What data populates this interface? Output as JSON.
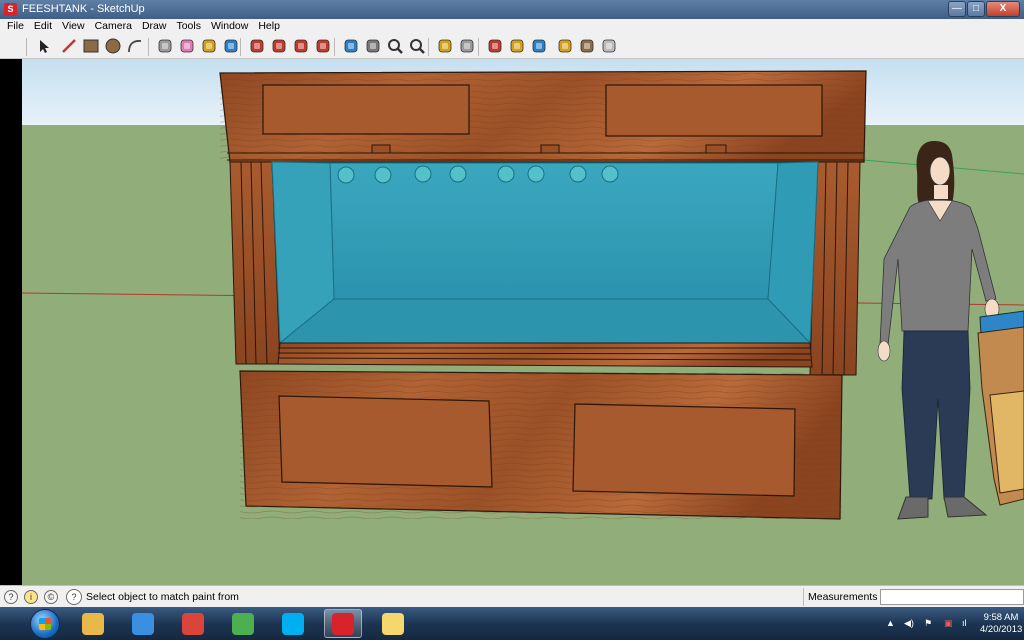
{
  "window": {
    "title": "FEESHTANK - SketchUp",
    "controls": {
      "minimize": "—",
      "maximize": "□",
      "close": "X"
    }
  },
  "menu": {
    "items": [
      "File",
      "Edit",
      "View",
      "Camera",
      "Draw",
      "Tools",
      "Window",
      "Help"
    ]
  },
  "toolbar": {
    "tools": [
      {
        "name": "select-tool-icon",
        "color": "#222222"
      },
      {
        "name": "line-tool-icon",
        "color": "#c0392b"
      },
      {
        "name": "rectangle-tool-icon",
        "color": "#8b6a45"
      },
      {
        "name": "circle-tool-icon",
        "color": "#8b6a45"
      },
      {
        "name": "arc-tool-icon",
        "color": "#444444"
      },
      {
        "name": "make-component-icon",
        "color": "#9a9a9a"
      },
      {
        "name": "eraser-tool-icon",
        "color": "#e07ab0"
      },
      {
        "name": "tape-measure-icon",
        "color": "#d4a017"
      },
      {
        "name": "paint-bucket-icon",
        "color": "#2a7fc9"
      },
      {
        "name": "push-pull-icon",
        "color": "#c0392b"
      },
      {
        "name": "move-tool-icon",
        "color": "#c0392b"
      },
      {
        "name": "rotate-tool-icon",
        "color": "#c0392b"
      },
      {
        "name": "offset-tool-icon",
        "color": "#c0392b"
      },
      {
        "name": "orbit-tool-icon",
        "color": "#2a7fc9"
      },
      {
        "name": "pan-tool-icon",
        "color": "#777777"
      },
      {
        "name": "zoom-tool-icon",
        "color": "#333333"
      },
      {
        "name": "zoom-extents-icon",
        "color": "#333333"
      },
      {
        "name": "previous-view-icon",
        "color": "#d4a017"
      },
      {
        "name": "next-view-icon",
        "color": "#9a9a9a"
      },
      {
        "name": "get-models-icon",
        "color": "#c0392b"
      },
      {
        "name": "share-model-icon",
        "color": "#d4a017"
      },
      {
        "name": "google-earth-icon",
        "color": "#2a7fc9"
      },
      {
        "name": "extension-warehouse-icon",
        "color": "#d4a017"
      },
      {
        "name": "components-icon",
        "color": "#8b6a45"
      },
      {
        "name": "styles-icon",
        "color": "#bbbbbb"
      }
    ]
  },
  "status": {
    "icons": [
      "info-icon",
      "credits-icon",
      "copyright-icon",
      "help-icon"
    ],
    "message": "Select object to match paint from",
    "measurements_label": "Measurements",
    "measurements_value": ""
  },
  "taskbar": {
    "apps": [
      {
        "name": "explorer-icon",
        "color": "#e8b84a",
        "active": false
      },
      {
        "name": "internet-explorer-icon",
        "color": "#3b8fe0",
        "active": false
      },
      {
        "name": "chrome-icon",
        "color": "#d9453b",
        "active": false
      },
      {
        "name": "messenger-icon",
        "color": "#4caf50",
        "active": false
      },
      {
        "name": "skype-icon",
        "color": "#00aff0",
        "active": false
      },
      {
        "name": "sketchup-icon",
        "color": "#d8232a",
        "active": true
      },
      {
        "name": "paint-icon",
        "color": "#f5d76e",
        "active": false
      }
    ],
    "time": "9:58 AM",
    "date": "4/20/2013"
  },
  "scene": {
    "sky_color": "#d3e7f5",
    "ground_color": "#91ad79",
    "wood_color": "#a0542a",
    "water_color": "#2d9ab3"
  }
}
